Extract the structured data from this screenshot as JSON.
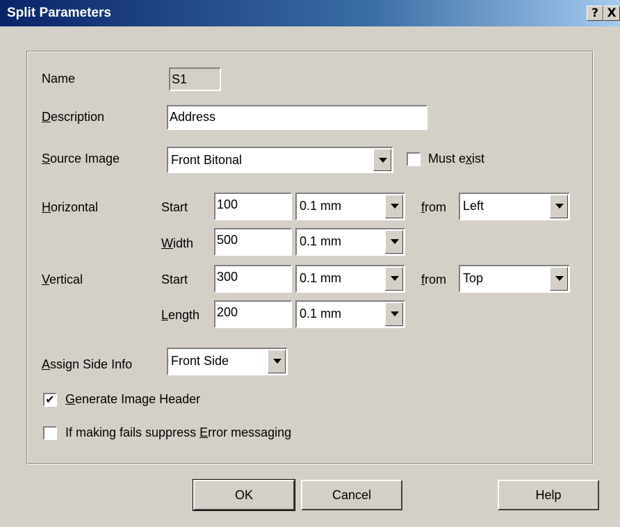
{
  "window": {
    "title": "Split Parameters",
    "help_glyph": "?",
    "close_glyph": "X"
  },
  "form": {
    "name_label": "Name",
    "name_value": "S1",
    "description_label_u": "D",
    "description_label_rest": "escription",
    "description_value": "Address",
    "source_label_u": "S",
    "source_label_rest": "ource Image",
    "source_value": "Front Bitonal",
    "must_exist_pre": "Must e",
    "must_exist_u": "x",
    "must_exist_post": "ist",
    "horizontal_label_u": "H",
    "horizontal_label_rest": "orizontal",
    "h_start_label": "Start",
    "h_start_value": "100",
    "h_start_unit": "0.1 mm",
    "h_from_u": "f",
    "h_from_rest": "rom",
    "h_from_value": "Left",
    "width_label_u": "W",
    "width_label_rest": "idth",
    "width_value": "500",
    "width_unit": "0.1 mm",
    "vertical_label_u": "V",
    "vertical_label_rest": "ertical",
    "v_start_label": "Start",
    "v_start_value": "300",
    "v_start_unit": "0.1 mm",
    "v_from_u": "f",
    "v_from_rest": "rom",
    "v_from_value": "Top",
    "length_label_u": "L",
    "length_label_rest": "ength",
    "length_value": "200",
    "length_unit": "0.1 mm",
    "side_label_u": "A",
    "side_label_rest": "ssign Side Info",
    "side_value": "Front Side",
    "gen_header_u": "G",
    "gen_header_rest": "enerate Image Header",
    "gen_header_checked": true,
    "suppress_pre": "If making fails suppress ",
    "suppress_u": "E",
    "suppress_post": "rror messaging",
    "suppress_checked": false,
    "must_exist_checked": false
  },
  "buttons": {
    "ok": "OK",
    "cancel": "Cancel",
    "help": "Help"
  },
  "glyphs": {
    "check": "✔"
  }
}
